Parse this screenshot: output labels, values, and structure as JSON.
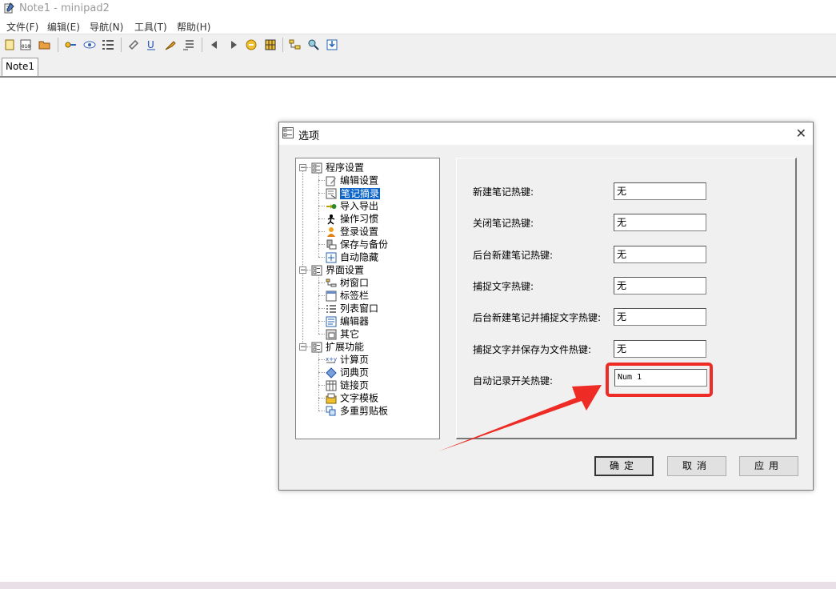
{
  "app": {
    "title": "Note1 - minipad2"
  },
  "menu": [
    "文件(F)",
    "编辑(E)",
    "导航(N)",
    "工具(T)",
    "帮助(H)"
  ],
  "toolbar_icons": [
    "new-note-icon",
    "binary-icon",
    "open-folder-icon",
    "key-icon",
    "view-icon",
    "list-icon",
    "link-icon",
    "underline-icon",
    "pin-icon",
    "stack-icon",
    "back-icon",
    "forward-icon",
    "recycle-icon",
    "grid-icon",
    "tree-icon",
    "search-icon",
    "save-icon"
  ],
  "tab": {
    "label": "Note1"
  },
  "dialog": {
    "title": "选项",
    "close_glyph": "✕",
    "tree": [
      {
        "label": "程序设置",
        "icon": "options-group-icon",
        "level": 0,
        "expander": "⊟"
      },
      {
        "label": "编辑设置",
        "icon": "edit-settings-icon",
        "level": 1
      },
      {
        "label": "笔记摘录",
        "icon": "note-excerpt-icon",
        "level": 1,
        "selected": true
      },
      {
        "label": "导入导出",
        "icon": "import-export-icon",
        "level": 1
      },
      {
        "label": "操作习惯",
        "icon": "habit-icon",
        "level": 1
      },
      {
        "label": "登录设置",
        "icon": "login-icon",
        "level": 1
      },
      {
        "label": "保存与备份",
        "icon": "backup-icon",
        "level": 1
      },
      {
        "label": "自动隐藏",
        "icon": "auto-hide-icon",
        "level": 1
      },
      {
        "label": "界面设置",
        "icon": "options-group-icon",
        "level": 0,
        "expander": "⊟"
      },
      {
        "label": "树窗口",
        "icon": "tree-window-icon",
        "level": 1
      },
      {
        "label": "标签栏",
        "icon": "tab-bar-icon",
        "level": 1
      },
      {
        "label": "列表窗口",
        "icon": "list-window-icon",
        "level": 1
      },
      {
        "label": "编辑器",
        "icon": "editor-icon",
        "level": 1
      },
      {
        "label": "其它",
        "icon": "other-icon",
        "level": 1
      },
      {
        "label": "扩展功能",
        "icon": "options-group-icon",
        "level": 0,
        "expander": "⊟"
      },
      {
        "label": "计算页",
        "icon": "calculator-icon",
        "level": 1
      },
      {
        "label": "词典页",
        "icon": "dictionary-icon",
        "level": 1
      },
      {
        "label": "链接页",
        "icon": "link-page-icon",
        "level": 1
      },
      {
        "label": "文字模板",
        "icon": "template-icon",
        "level": 1
      },
      {
        "label": "多重剪贴板",
        "icon": "clipboard-icon",
        "level": 1
      }
    ],
    "hotkeys": [
      {
        "label": "新建笔记热键:",
        "value": "无"
      },
      {
        "label": "关闭笔记热键:",
        "value": "无"
      },
      {
        "label": "后台新建笔记热键:",
        "value": "无"
      },
      {
        "label": "捕捉文字热键:",
        "value": "无"
      },
      {
        "label": "后台新建笔记并捕捉文字热键:",
        "value": "无"
      },
      {
        "label": "捕捉文字并保存为文件热键:",
        "value": "无"
      },
      {
        "label": "自动记录开关热键:",
        "value": "Num 1"
      }
    ],
    "buttons": {
      "ok": "确定",
      "cancel": "取消",
      "apply": "应用"
    }
  },
  "annotation": {
    "highlight_color": "#ee2b24"
  },
  "colors": {
    "selection": "#0a64c8"
  }
}
